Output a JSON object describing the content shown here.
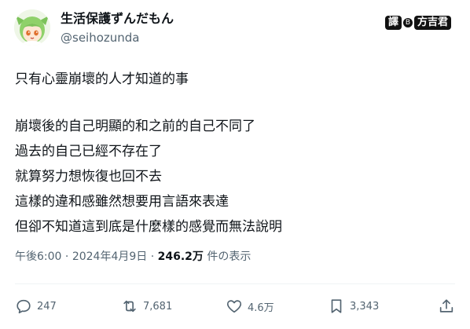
{
  "author": {
    "display_name": "生活保護ずんだもん",
    "handle": "@seihozunda",
    "avatar_icon": "zundamon-avatar"
  },
  "watermark": {
    "part1": "譯",
    "dot": "B",
    "part2": "方吉君"
  },
  "tweet": {
    "lines": [
      "只有心靈崩壞的人才知道的事",
      "",
      "崩壞後的自己明顯的和之前的自己不同了",
      "過去的自己已經不存在了",
      "就算努力想恢復也回不去",
      "這樣的違和感雖然想要用言語來表達",
      "但卻不知道這到底是什麼樣的感覺而無法說明"
    ]
  },
  "meta": {
    "time": "午後6:00",
    "separator": " · ",
    "date": "2024年4月9日",
    "views_count": "246.2万",
    "views_label": " 件の表示"
  },
  "actions": {
    "reply_count": "247",
    "retweet_count": "7,681",
    "like_count": "4.6万",
    "bookmark_count": "3,343"
  },
  "colors": {
    "text": "#0f1419",
    "secondary": "#536471",
    "divider": "#eff3f4"
  }
}
